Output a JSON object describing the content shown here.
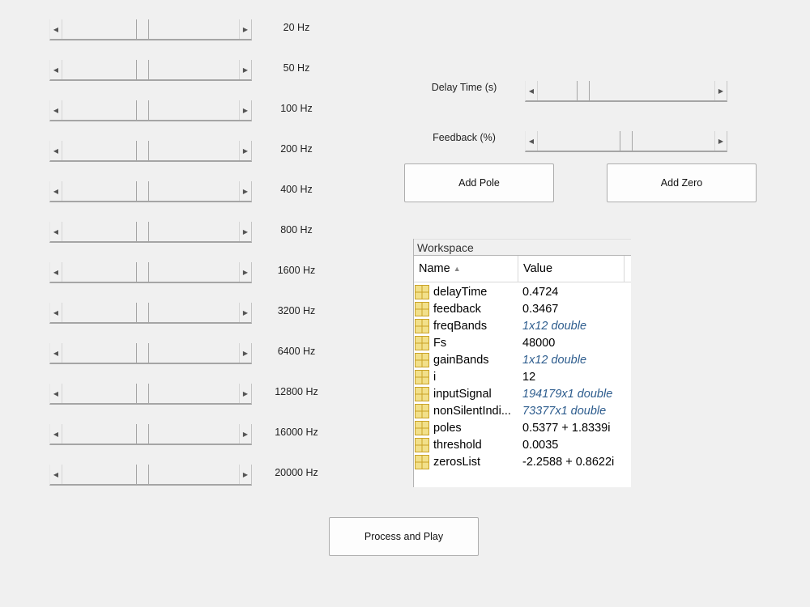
{
  "equalizer": {
    "bands": [
      {
        "label": "20 Hz",
        "level": 0.45
      },
      {
        "label": "50 Hz",
        "level": 0.45
      },
      {
        "label": "100 Hz",
        "level": 0.45
      },
      {
        "label": "200 Hz",
        "level": 0.45
      },
      {
        "label": "400 Hz",
        "level": 0.45
      },
      {
        "label": "800 Hz",
        "level": 0.45
      },
      {
        "label": "1600 Hz",
        "level": 0.45
      },
      {
        "label": "3200 Hz",
        "level": 0.45
      },
      {
        "label": "6400 Hz",
        "level": 0.45
      },
      {
        "label": "12800 Hz",
        "level": 0.45
      },
      {
        "label": "16000 Hz",
        "level": 0.45
      },
      {
        "label": "20000 Hz",
        "level": 0.45
      }
    ]
  },
  "delay": {
    "label": "Delay Time (s)",
    "level": 0.24
  },
  "feedback": {
    "label": "Feedback (%)",
    "level": 0.5
  },
  "buttons": {
    "add_pole": "Add Pole",
    "add_zero": "Add Zero",
    "process": "Process and Play"
  },
  "workspace": {
    "title": "Workspace",
    "col_name": "Name",
    "col_value": "Value",
    "sort_glyph": "▲",
    "icon": "variable-matrix-icon",
    "rows": [
      {
        "name": "delayTime",
        "value": "0.4724",
        "link": false
      },
      {
        "name": "feedback",
        "value": "0.3467",
        "link": false
      },
      {
        "name": "freqBands",
        "value": "1x12 double",
        "link": true
      },
      {
        "name": "Fs",
        "value": "48000",
        "link": false
      },
      {
        "name": "gainBands",
        "value": "1x12 double",
        "link": true
      },
      {
        "name": "i",
        "value": "12",
        "link": false
      },
      {
        "name": "inputSignal",
        "value": "194179x1 double",
        "link": true
      },
      {
        "name": "nonSilentIndi...",
        "value": "73377x1 double",
        "link": true
      },
      {
        "name": "poles",
        "value": "0.5377 + 1.8339i",
        "link": false
      },
      {
        "name": "threshold",
        "value": "0.0035",
        "link": false
      },
      {
        "name": "zerosList",
        "value": "-2.2588 + 0.8622i",
        "link": false
      }
    ]
  },
  "colors": {
    "background": "#f0f0f0",
    "link_value": "#2e5d8e",
    "icon_fill": "#f2e08a",
    "icon_grid": "#c9a227"
  }
}
